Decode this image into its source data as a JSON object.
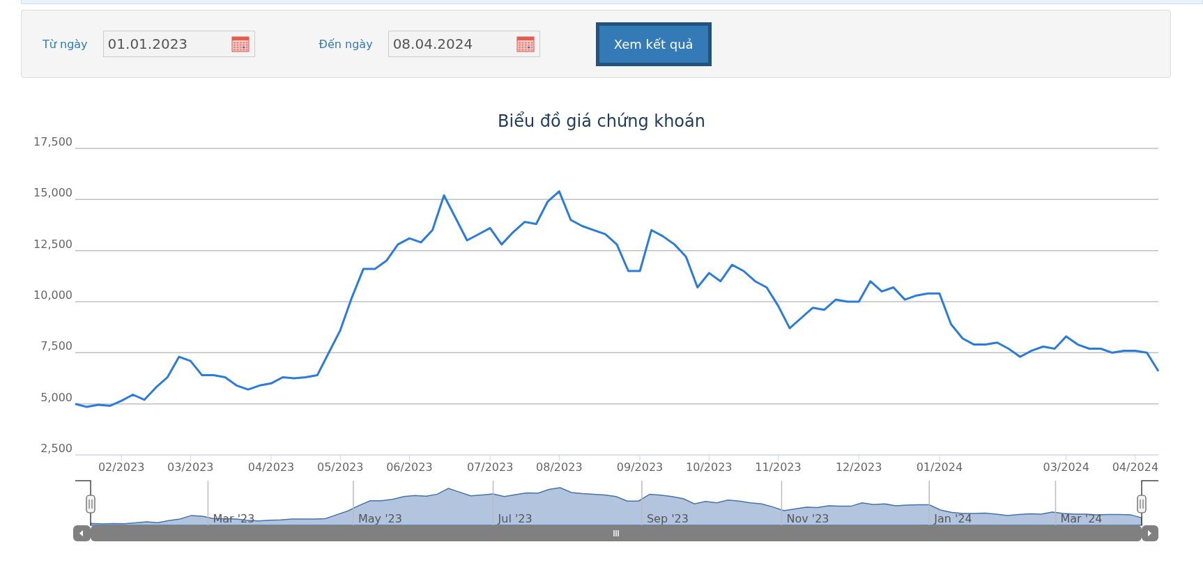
{
  "filter": {
    "from": {
      "label": "Từ ngày",
      "value": "01.01.2023"
    },
    "to": {
      "label": "Đến ngày",
      "value": "08.04.2024"
    },
    "submit": "Xem kết quả"
  },
  "chart": {
    "chart_data": {
      "type": "line",
      "title": "Biểu đồ giá chứng khoán",
      "grid": true,
      "ylim": [
        2500,
        17500
      ],
      "yticks": [
        {
          "value": 2500,
          "label": "2,500"
        },
        {
          "value": 5000,
          "label": "5,000"
        },
        {
          "value": 7500,
          "label": "7,500"
        },
        {
          "value": 10000,
          "label": "10,000"
        },
        {
          "value": 12500,
          "label": "12,500"
        },
        {
          "value": 15000,
          "label": "15,000"
        },
        {
          "value": 17500,
          "label": "17,500"
        }
      ],
      "categories": [
        null,
        null,
        null,
        null,
        "02/2023",
        null,
        null,
        null,
        null,
        null,
        "03/2023",
        null,
        null,
        null,
        null,
        null,
        null,
        "04/2023",
        null,
        null,
        null,
        null,
        null,
        "05/2023",
        null,
        null,
        null,
        null,
        null,
        "06/2023",
        null,
        null,
        null,
        null,
        null,
        null,
        "07/2023",
        null,
        null,
        null,
        null,
        null,
        "08/2023",
        null,
        null,
        null,
        null,
        null,
        null,
        "09/2023",
        null,
        null,
        null,
        null,
        null,
        "10/2023",
        null,
        null,
        null,
        null,
        null,
        "11/2023",
        null,
        null,
        null,
        null,
        null,
        null,
        "12/2023",
        null,
        null,
        null,
        null,
        null,
        null,
        "01/2024",
        null,
        null,
        null,
        null,
        null,
        null,
        null,
        null,
        null,
        null,
        "03/2024",
        null,
        null,
        null,
        null,
        null,
        "04/2024",
        null,
        null
      ],
      "series": [
        {
          "color": "#2b7bd9",
          "values": [
            5000,
            4850,
            4950,
            4900,
            5150,
            5450,
            5200,
            5800,
            6300,
            7300,
            7100,
            6400,
            6400,
            6300,
            5900,
            5700,
            5900,
            6000,
            6300,
            6250,
            6300,
            6400,
            7500,
            8600,
            10200,
            11600,
            11600,
            12000,
            12800,
            13100,
            12900,
            13500,
            15200,
            14100,
            13000,
            13300,
            13600,
            12800,
            13400,
            13900,
            13800,
            14900,
            15400,
            14000,
            13700,
            13500,
            13300,
            12800,
            11500,
            11500,
            13500,
            13200,
            12800,
            12200,
            10700,
            11400,
            11000,
            11800,
            11500,
            11000,
            10700,
            9800,
            8700,
            9200,
            9700,
            9600,
            10100,
            10000,
            10000,
            11000,
            10500,
            10700,
            10100,
            10300,
            10400,
            10400,
            8900,
            8200,
            7900,
            7900,
            8000,
            7700,
            7300,
            7600,
            7800,
            7700,
            8300,
            7900,
            7700,
            7700,
            7500,
            7600,
            7600,
            7500,
            6600
          ]
        }
      ]
    }
  },
  "navigator": {
    "labels": [
      "Mar '23",
      "May '23",
      "Jul '23",
      "Sep '23",
      "Nov '23",
      "Jan '24",
      "Mar '24"
    ]
  }
}
